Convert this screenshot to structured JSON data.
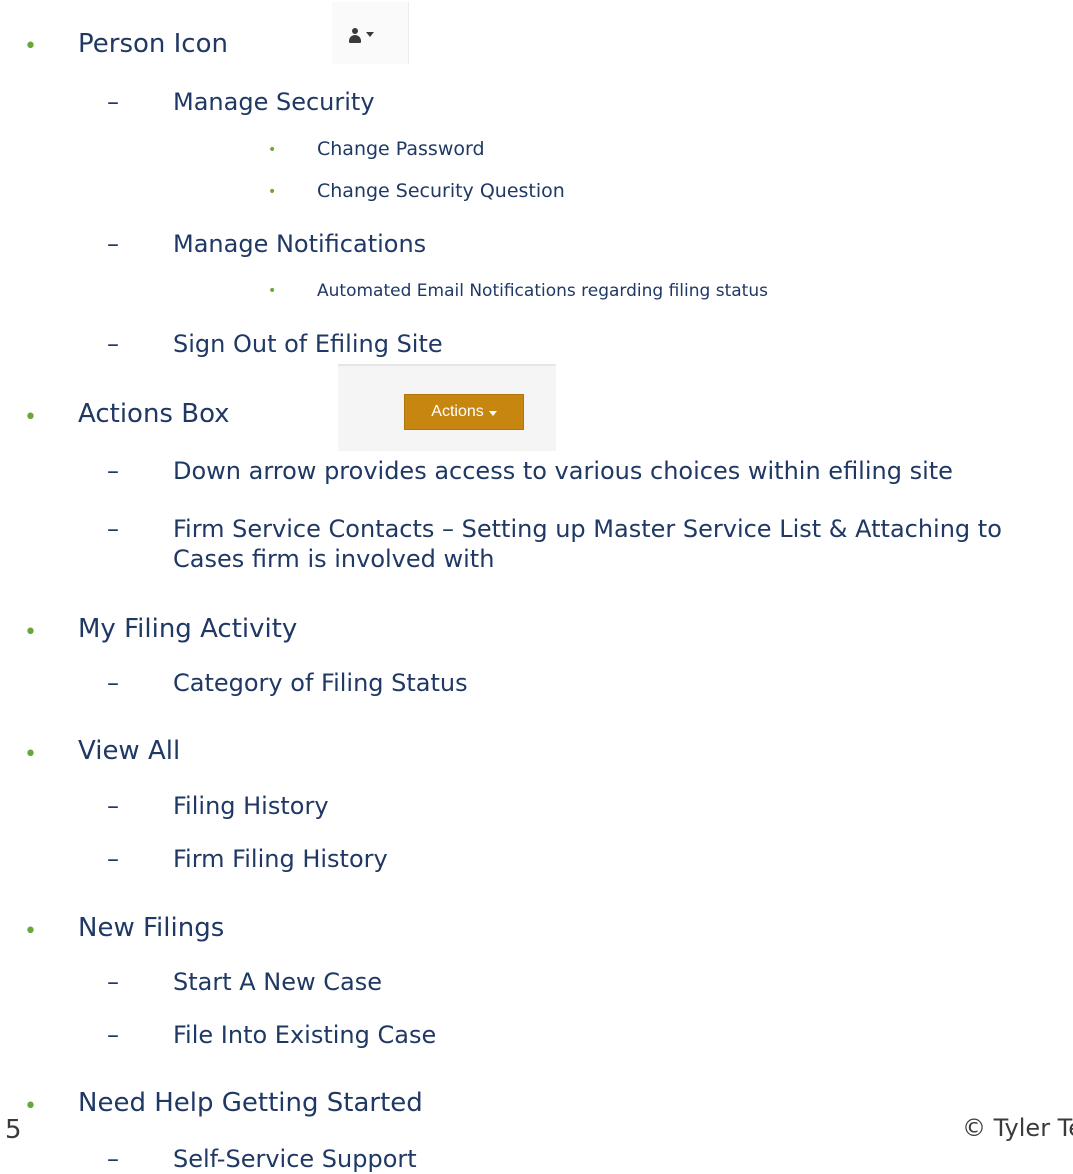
{
  "items": [
    {
      "text": "Person Icon"
    },
    {
      "text": "Manage Security"
    },
    {
      "text": "Change Password"
    },
    {
      "text": "Change Security Question"
    },
    {
      "text": "Manage Notifications"
    },
    {
      "text": "Automated Email Notifications regarding filing status"
    },
    {
      "text": "Sign Out of Efiling Site"
    },
    {
      "text": "Actions Box"
    },
    {
      "text": "Down arrow provides access to various choices within efiling site"
    },
    {
      "text": "Firm Service Contacts – Setting up Master Service List & Attaching to"
    },
    {
      "text": "Cases firm is involved with"
    },
    {
      "text": "My Filing Activity"
    },
    {
      "text": "Category of Filing Status"
    },
    {
      "text": "View All"
    },
    {
      "text": "Filing History"
    },
    {
      "text": "Firm Filing History"
    },
    {
      "text": "New Filings"
    },
    {
      "text": "Start A New Case"
    },
    {
      "text": "File Into Existing Case"
    },
    {
      "text": "Need Help Getting Started"
    },
    {
      "text": "Self-Service Support"
    }
  ],
  "actions_button_label": "Actions",
  "footer": {
    "page_number": "5",
    "copyright": "© Tyler Te"
  },
  "icons": {
    "person": "person-icon",
    "caret": "caret-down-icon"
  },
  "colors": {
    "text": "#1f3864",
    "bullet": "#6aa63a",
    "actions_button": "#c7860f"
  }
}
